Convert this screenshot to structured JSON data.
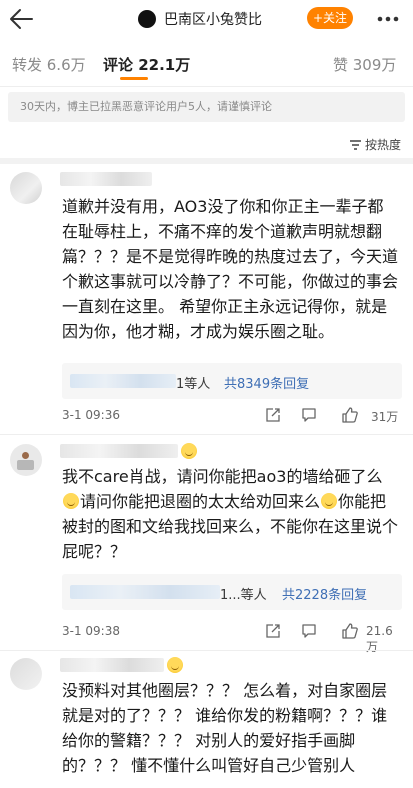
{
  "header": {
    "title": "巴南区小兔赞比",
    "follow_label": "+关注"
  },
  "tabs": [
    {
      "label": "转发 6.6万"
    },
    {
      "label": "评论 22.1万"
    },
    {
      "label": "赞 309万"
    }
  ],
  "notice": "30天内，博主已拉黑恶意评论用户5人，请谨慎评论",
  "sort_label": "按热度",
  "comments": [
    {
      "text": "道歉并没有用，AO3没了你和你正主一辈子都在耻辱柱上，不痛不痒的发个道歉声明就想翻篇？？？是不是觉得昨晚的热度过去了，今天道个歉这事就可以冷静了？不可能，你做过的事会一直刻在这里。 希望你正主永远记得你，就是因为你，他才糊，才成为娱乐圈之耻。",
      "reply_suffix": "1等人",
      "reply_count": "共8349条回复",
      "time": "3-1 09:36",
      "likes": "31万"
    },
    {
      "text_parts": [
        "我不care肖战，请问你能把ao3的墙给砸了么",
        "请问你能把退圈的太太给劝回来么",
        "你能把被封的图和文给我找回来么，不能你在这里说个屁呢？？"
      ],
      "reply_suffix": "1...等人",
      "reply_count": "共2228条回复",
      "time": "3-1 09:38",
      "likes": "21.6万"
    },
    {
      "text": "没预料对其他圈层？？？ 怎么着，对自家圈层就是对的了？？？ 谁给你发的粉籍啊？？？谁给你的警籍？？？ 对别人的爱好指手画脚的？？？ 懂不懂什么叫管好自己少管别人"
    }
  ],
  "colors": {
    "accent": "#ff8200",
    "link": "#3f6fb5",
    "notice_bg": "#f2f2f2"
  }
}
